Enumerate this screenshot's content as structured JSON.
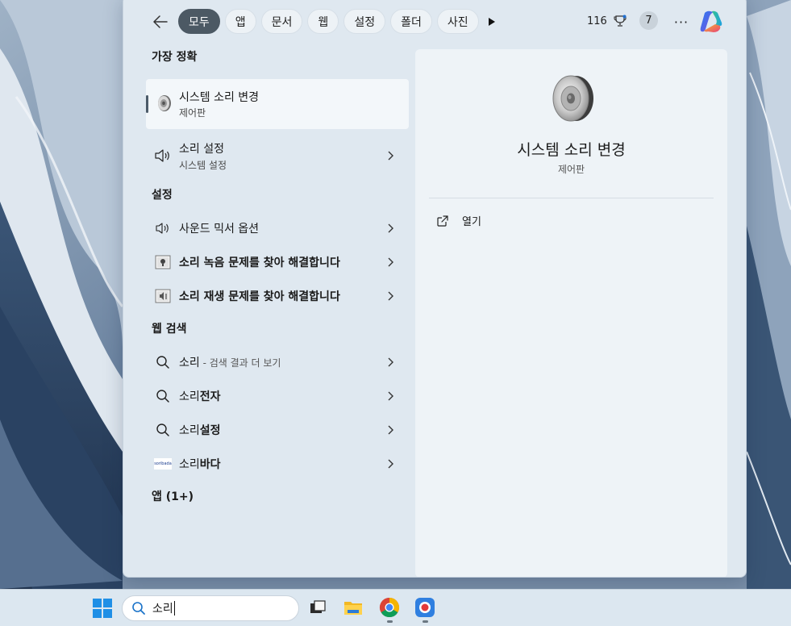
{
  "topbar": {
    "filters": [
      {
        "label": "모두",
        "active": true
      },
      {
        "label": "앱"
      },
      {
        "label": "문서"
      },
      {
        "label": "웹"
      },
      {
        "label": "설정"
      },
      {
        "label": "폴더"
      },
      {
        "label": "사진"
      }
    ],
    "points": "116",
    "notification_count": "7",
    "more_label": "···"
  },
  "results": {
    "best_match_heading": "가장 정확",
    "best_match": {
      "title": "시스템 소리 변경",
      "subtitle": "제어판"
    },
    "sound_settings": {
      "title": "소리 설정",
      "subtitle": "시스템 설정"
    },
    "settings_heading": "설정",
    "settings_items": [
      {
        "label": "사운드 믹서 옵션",
        "icon": "speaker-icon"
      },
      {
        "label_bold": "소리",
        "label_rest": " 녹음 문제를 찾아 해결합니다",
        "icon": "troubleshoot-record-icon"
      },
      {
        "label_bold": "소리",
        "label_rest": " 재생 문제를 찾아 해결합니다",
        "icon": "troubleshoot-play-icon"
      }
    ],
    "web_heading": "웹 검색",
    "web_items": [
      {
        "label": "소리",
        "muted": " - 검색 결과 더 보기"
      },
      {
        "label": "소리",
        "label_bold": "전자"
      },
      {
        "label": "소리",
        "label_bold": "설정"
      },
      {
        "label": "소리",
        "label_bold": "바다",
        "icon_text": "soribada"
      }
    ],
    "apps_heading": "앱 (1+)"
  },
  "detail": {
    "title": "시스템 소리 변경",
    "subtitle": "제어판",
    "open_label": "열기"
  },
  "taskbar": {
    "search_value": "소리"
  },
  "colors": {
    "active_chip": "#4c5964",
    "panel_bg": "#dfe8f0",
    "taskbar_bg": "#dce7f0"
  }
}
